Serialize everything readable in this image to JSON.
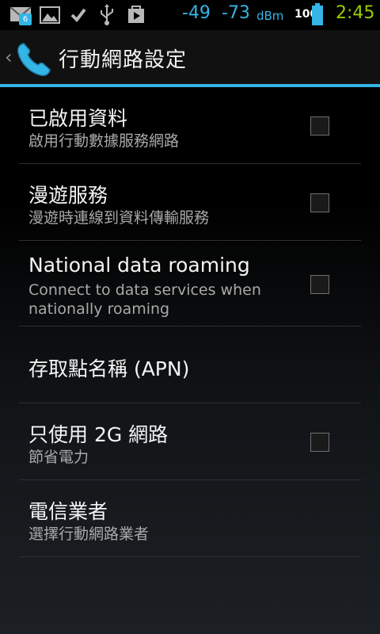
{
  "status_bar": {
    "mail_badge": "6",
    "signal_1": "-49",
    "signal_2": "-73",
    "signal_unit": "dBm",
    "battery_level": "100",
    "time": "2:45",
    "colors": {
      "signal": "#33b5e5",
      "time": "#99cc00"
    },
    "icons": [
      "mail-icon",
      "image-icon",
      "check-icon",
      "usb-icon",
      "play-store-icon",
      "battery-icon"
    ]
  },
  "action_bar": {
    "title": "行動網路設定",
    "icon": "phone-icon",
    "accent_color": "#33b5e5"
  },
  "settings": [
    {
      "title": "已啟用資料",
      "summary": "啟用行動數據服務網路",
      "checkbox": true,
      "checked": false
    },
    {
      "title": "漫遊服務",
      "summary": "漫遊時連線到資料傳輸服務",
      "checkbox": true,
      "checked": false
    },
    {
      "title": "National data roaming",
      "summary": "Connect to data services when nationally roaming",
      "checkbox": true,
      "checked": false
    },
    {
      "title": "存取點名稱 (APN)",
      "summary": "",
      "checkbox": false
    },
    {
      "title": "只使用 2G 網路",
      "summary": "節省電力",
      "checkbox": true,
      "checked": false
    },
    {
      "title": "電信業者",
      "summary": "選擇行動網路業者",
      "checkbox": false
    }
  ]
}
